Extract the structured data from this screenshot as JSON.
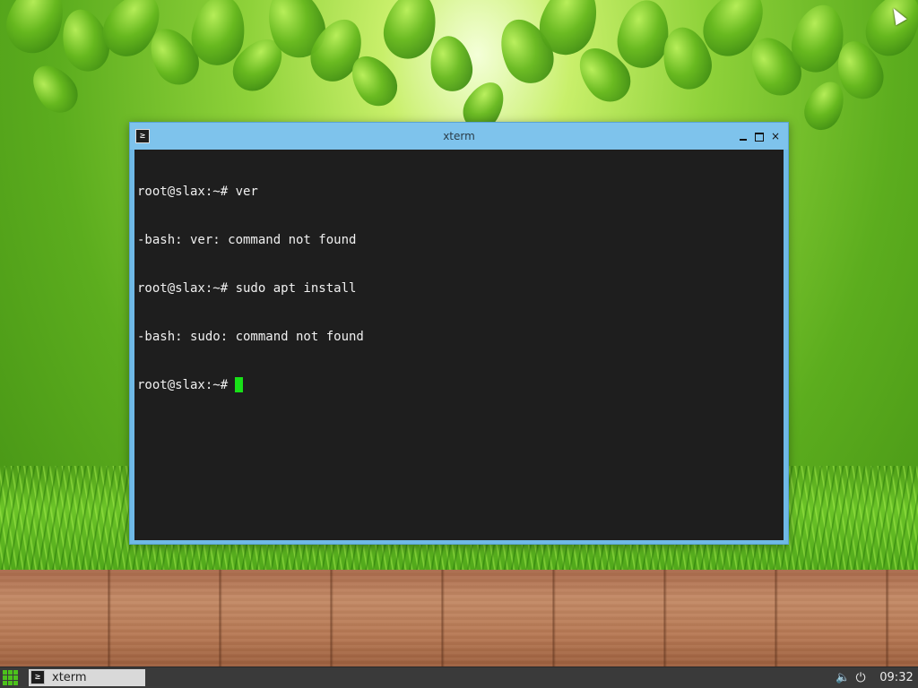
{
  "window": {
    "title": "xterm",
    "icon": "terminal-icon",
    "icon_glyph": "≥",
    "controls": {
      "minimize": "",
      "maximize": "",
      "close": "×"
    },
    "border_color": "#6fb9e6"
  },
  "terminal": {
    "lines": [
      "root@slax:~# ver",
      "-bash: ver: command not found",
      "root@slax:~# sudo apt install",
      "-bash: sudo: command not found"
    ],
    "prompt": "root@slax:~#",
    "background": "#1e1e1e",
    "foreground": "#f0f0f0",
    "cursor_color": "#18e018"
  },
  "taskbar": {
    "start_icon": "app-grid-icon",
    "tasks": [
      {
        "label": "xterm",
        "icon": "terminal-icon",
        "icon_glyph": "≥"
      }
    ],
    "tray": {
      "volume_icon": "volume-muted-icon",
      "volume_glyph": "🔈",
      "power_icon": "power-icon",
      "power_glyph": "⏻",
      "clock": "09:32"
    }
  }
}
